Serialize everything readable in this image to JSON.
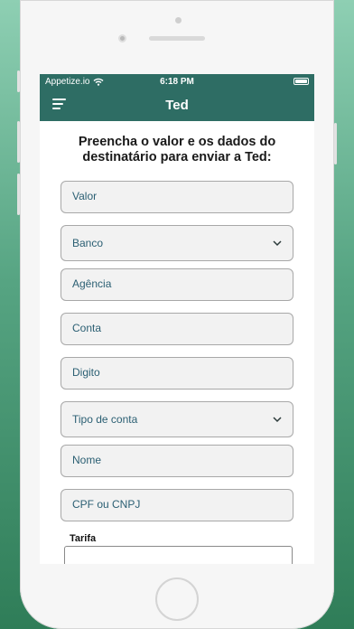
{
  "status_bar": {
    "carrier": "Appetize.io",
    "time": "6:18 PM"
  },
  "app_bar": {
    "title": "Ted"
  },
  "heading": "Preencha o valor e os dados do destinatário para enviar a Ted:",
  "form": {
    "valor": "Valor",
    "banco": "Banco",
    "agencia": "Agência",
    "conta": "Conta",
    "digito": "Digito",
    "tipo_conta": "Tipo de conta",
    "nome": "Nome",
    "cpf_cnpj": "CPF ou CNPJ",
    "tarifa_label": "Tarifa"
  },
  "colors": {
    "header": "#2e6d64",
    "field_text": "#2b5f73"
  }
}
